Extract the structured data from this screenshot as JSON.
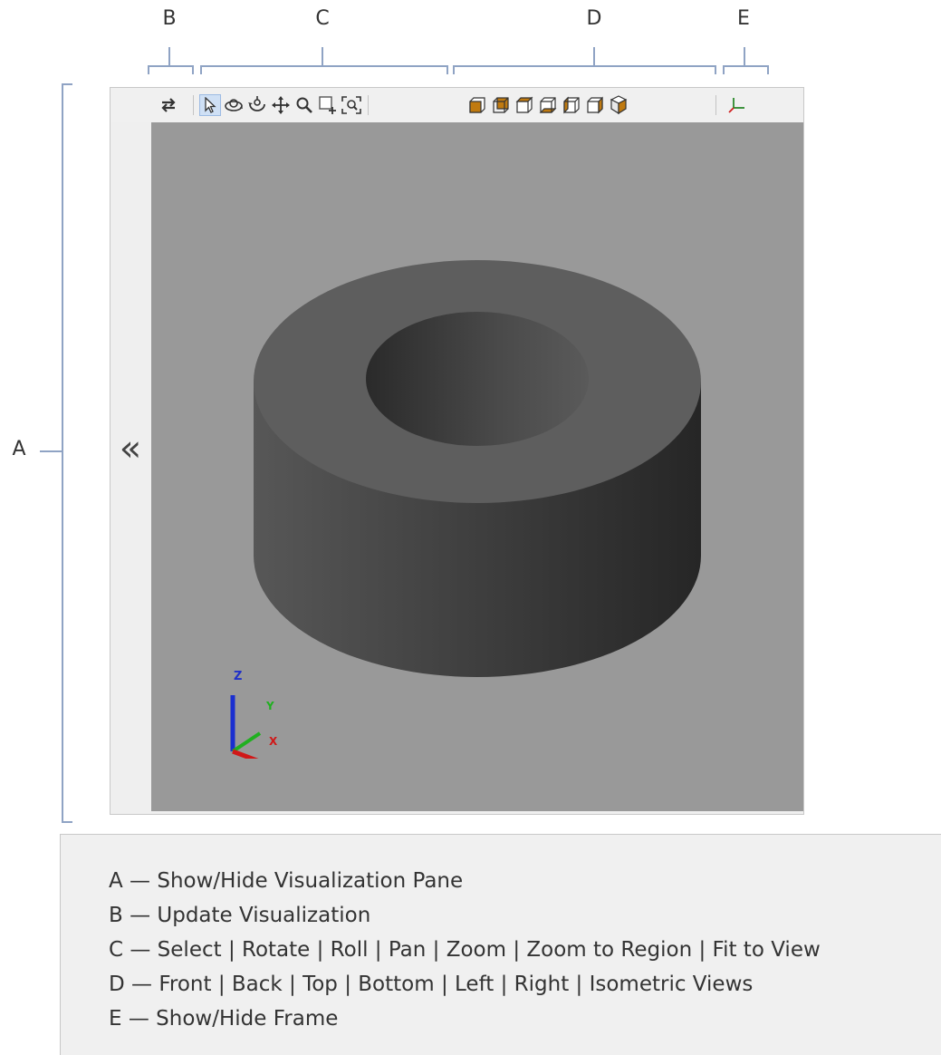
{
  "callouts": {
    "a": "A",
    "b": "B",
    "c": "C",
    "d": "D",
    "e": "E"
  },
  "toolbar": {
    "update": {
      "icon": "update-visualization-icon"
    },
    "camera_tools": [
      {
        "icon": "select-icon",
        "active": true
      },
      {
        "icon": "rotate-icon"
      },
      {
        "icon": "roll-icon"
      },
      {
        "icon": "pan-icon"
      },
      {
        "icon": "zoom-icon"
      },
      {
        "icon": "zoom-to-region-icon"
      },
      {
        "icon": "fit-to-view-icon"
      }
    ],
    "views": [
      {
        "icon": "front-view-icon"
      },
      {
        "icon": "back-view-icon"
      },
      {
        "icon": "top-view-icon"
      },
      {
        "icon": "bottom-view-icon"
      },
      {
        "icon": "left-view-icon"
      },
      {
        "icon": "right-view-icon"
      },
      {
        "icon": "isometric-view-icon"
      }
    ],
    "frame": {
      "icon": "show-hide-frame-icon"
    },
    "accent_color": "#c07a10"
  },
  "pane": {
    "collapse_glyph": "«",
    "viewport_color": "#999999"
  },
  "axes": {
    "z": "Z",
    "y": "Y",
    "x": "X"
  },
  "legend": {
    "lines": [
      "A — Show/Hide Visualization Pane",
      "B — Update Visualization",
      "C — Select | Rotate | Roll | Pan | Zoom | Zoom to Region | Fit to View",
      "D — Front | Back | Top | Bottom | Left | Right | Isometric Views",
      "E — Show/Hide Frame"
    ]
  }
}
